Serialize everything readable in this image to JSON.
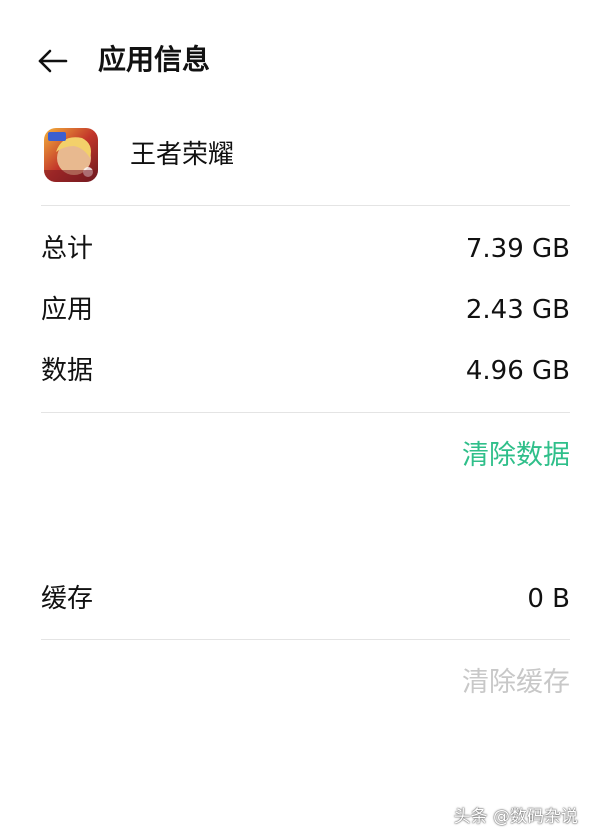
{
  "header": {
    "back_icon": "arrow-left-icon",
    "title": "应用信息"
  },
  "app": {
    "icon": "game-app-icon",
    "name": "王者荣耀"
  },
  "storage": {
    "total_label": "总计",
    "total_value": "7.39 GB",
    "app_label": "应用",
    "app_value": "2.43 GB",
    "data_label": "数据",
    "data_value": "4.96 GB",
    "clear_data_label": "清除数据"
  },
  "cache": {
    "label": "缓存",
    "value": "0 B",
    "clear_cache_label": "清除缓存"
  },
  "watermark": "头条 @数码杂说",
  "colors": {
    "accent": "#2fbf8a",
    "disabled": "#c8c8c8",
    "divider": "#e4e4e4"
  }
}
